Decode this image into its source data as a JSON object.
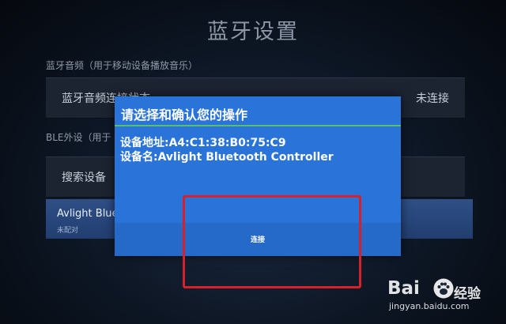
{
  "screen": {
    "title": "蓝牙设置"
  },
  "audio_section": {
    "label": "蓝牙音频（用于移动设备播放音乐）",
    "row_label": "蓝牙音频连接状态",
    "row_status": "未连接"
  },
  "ble_section": {
    "label": "BLE外设（用于",
    "search_label": "搜索设备",
    "device_name": "Avlight Blue",
    "device_sub": "未配对"
  },
  "dialog": {
    "title": "请选择和确认您的操作",
    "address_line": "设备地址:A4:C1:38:B0:75:C9",
    "name_line": "设备名:Avlight Bluetooth Controller",
    "connect_label": "连接"
  },
  "colors": {
    "dialog_bg": "#2a73d8",
    "divider": "#58c06a",
    "highlight": "#d8202a"
  },
  "watermark": {
    "brand": "Bai",
    "brand_cn": "经验",
    "url": "jingyan.baidu.com"
  }
}
